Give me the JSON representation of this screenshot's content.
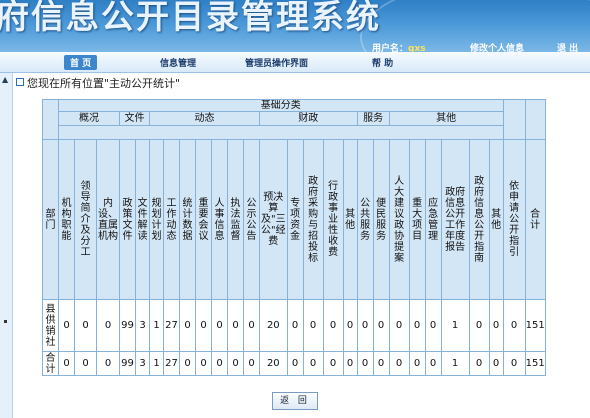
{
  "header": {
    "title": "府信息公开目录管理系统",
    "user_label": "用户名：",
    "user_name": "gxs",
    "edit_profile": "修改个人信息",
    "logout": "退 出"
  },
  "nav": {
    "items": [
      {
        "label": "首 页"
      },
      {
        "label": "信息管理"
      },
      {
        "label": "管理员操作界面"
      },
      {
        "label": "帮 助"
      }
    ]
  },
  "breadcrumb": "您现在所有位置\"主动公开统计\"",
  "table": {
    "top_header": "基础分类",
    "groups": {
      "overview": "概况",
      "documents": "文件",
      "dynamics": "动态",
      "finance": "财政",
      "services": "服务",
      "others": "其他"
    },
    "dept_header": "部门",
    "application_header": "依申请公开指引",
    "total_header": "合计",
    "columns": [
      "机构职能",
      "领导简介及分工",
      "内设、直属机构",
      "政策文件",
      "文件解读",
      "规划计划",
      "工作动态",
      "统计数据",
      "重要会议",
      "人事信息",
      "执法监督",
      "公示公告",
      "预决算及\"三公\"经费",
      "专项资金",
      "政府采购与招投标",
      "行政事业性收费",
      "其他",
      "公共服务",
      "便民服务",
      "人大建议政协提案",
      "重大项目",
      "应急管理",
      "政府信息公开工作年度报告",
      "政府信息公开指南",
      "其他"
    ],
    "rows": [
      {
        "dept": "县供销社",
        "values": [
          "0",
          "0",
          "0",
          "99",
          "3",
          "1",
          "27",
          "0",
          "0",
          "0",
          "0",
          "0",
          "20",
          "0",
          "0",
          "0",
          "0",
          "0",
          "0",
          "0",
          "0",
          "0",
          "1",
          "0",
          "0"
        ],
        "application": "0",
        "total": "151"
      },
      {
        "dept": "合计",
        "values": [
          "0",
          "0",
          "0",
          "99",
          "3",
          "1",
          "27",
          "0",
          "0",
          "0",
          "0",
          "0",
          "20",
          "0",
          "0",
          "0",
          "0",
          "0",
          "0",
          "0",
          "0",
          "0",
          "1",
          "0",
          "0"
        ],
        "application": "0",
        "total": "151"
      }
    ]
  },
  "back_button": "返 回"
}
